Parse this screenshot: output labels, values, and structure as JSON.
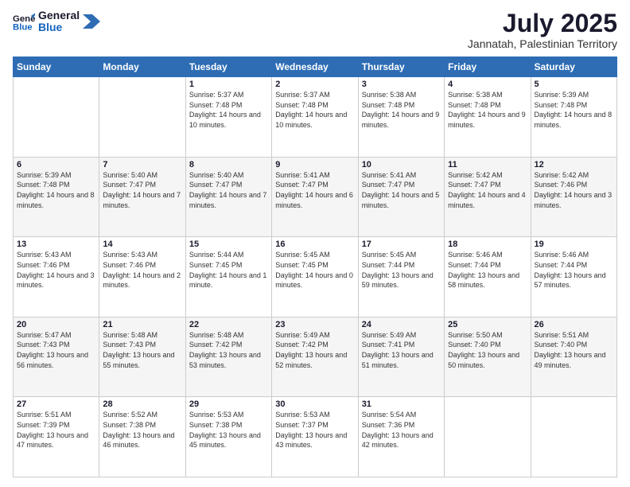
{
  "logo": {
    "line1": "General",
    "line2": "Blue"
  },
  "title": "July 2025",
  "subtitle": "Jannatah, Palestinian Territory",
  "days_of_week": [
    "Sunday",
    "Monday",
    "Tuesday",
    "Wednesday",
    "Thursday",
    "Friday",
    "Saturday"
  ],
  "weeks": [
    [
      {
        "day": "",
        "info": ""
      },
      {
        "day": "",
        "info": ""
      },
      {
        "day": "1",
        "info": "Sunrise: 5:37 AM\nSunset: 7:48 PM\nDaylight: 14 hours and 10 minutes."
      },
      {
        "day": "2",
        "info": "Sunrise: 5:37 AM\nSunset: 7:48 PM\nDaylight: 14 hours and 10 minutes."
      },
      {
        "day": "3",
        "info": "Sunrise: 5:38 AM\nSunset: 7:48 PM\nDaylight: 14 hours and 9 minutes."
      },
      {
        "day": "4",
        "info": "Sunrise: 5:38 AM\nSunset: 7:48 PM\nDaylight: 14 hours and 9 minutes."
      },
      {
        "day": "5",
        "info": "Sunrise: 5:39 AM\nSunset: 7:48 PM\nDaylight: 14 hours and 8 minutes."
      }
    ],
    [
      {
        "day": "6",
        "info": "Sunrise: 5:39 AM\nSunset: 7:48 PM\nDaylight: 14 hours and 8 minutes."
      },
      {
        "day": "7",
        "info": "Sunrise: 5:40 AM\nSunset: 7:47 PM\nDaylight: 14 hours and 7 minutes."
      },
      {
        "day": "8",
        "info": "Sunrise: 5:40 AM\nSunset: 7:47 PM\nDaylight: 14 hours and 7 minutes."
      },
      {
        "day": "9",
        "info": "Sunrise: 5:41 AM\nSunset: 7:47 PM\nDaylight: 14 hours and 6 minutes."
      },
      {
        "day": "10",
        "info": "Sunrise: 5:41 AM\nSunset: 7:47 PM\nDaylight: 14 hours and 5 minutes."
      },
      {
        "day": "11",
        "info": "Sunrise: 5:42 AM\nSunset: 7:47 PM\nDaylight: 14 hours and 4 minutes."
      },
      {
        "day": "12",
        "info": "Sunrise: 5:42 AM\nSunset: 7:46 PM\nDaylight: 14 hours and 3 minutes."
      }
    ],
    [
      {
        "day": "13",
        "info": "Sunrise: 5:43 AM\nSunset: 7:46 PM\nDaylight: 14 hours and 3 minutes."
      },
      {
        "day": "14",
        "info": "Sunrise: 5:43 AM\nSunset: 7:46 PM\nDaylight: 14 hours and 2 minutes."
      },
      {
        "day": "15",
        "info": "Sunrise: 5:44 AM\nSunset: 7:45 PM\nDaylight: 14 hours and 1 minute."
      },
      {
        "day": "16",
        "info": "Sunrise: 5:45 AM\nSunset: 7:45 PM\nDaylight: 14 hours and 0 minutes."
      },
      {
        "day": "17",
        "info": "Sunrise: 5:45 AM\nSunset: 7:44 PM\nDaylight: 13 hours and 59 minutes."
      },
      {
        "day": "18",
        "info": "Sunrise: 5:46 AM\nSunset: 7:44 PM\nDaylight: 13 hours and 58 minutes."
      },
      {
        "day": "19",
        "info": "Sunrise: 5:46 AM\nSunset: 7:44 PM\nDaylight: 13 hours and 57 minutes."
      }
    ],
    [
      {
        "day": "20",
        "info": "Sunrise: 5:47 AM\nSunset: 7:43 PM\nDaylight: 13 hours and 56 minutes."
      },
      {
        "day": "21",
        "info": "Sunrise: 5:48 AM\nSunset: 7:43 PM\nDaylight: 13 hours and 55 minutes."
      },
      {
        "day": "22",
        "info": "Sunrise: 5:48 AM\nSunset: 7:42 PM\nDaylight: 13 hours and 53 minutes."
      },
      {
        "day": "23",
        "info": "Sunrise: 5:49 AM\nSunset: 7:42 PM\nDaylight: 13 hours and 52 minutes."
      },
      {
        "day": "24",
        "info": "Sunrise: 5:49 AM\nSunset: 7:41 PM\nDaylight: 13 hours and 51 minutes."
      },
      {
        "day": "25",
        "info": "Sunrise: 5:50 AM\nSunset: 7:40 PM\nDaylight: 13 hours and 50 minutes."
      },
      {
        "day": "26",
        "info": "Sunrise: 5:51 AM\nSunset: 7:40 PM\nDaylight: 13 hours and 49 minutes."
      }
    ],
    [
      {
        "day": "27",
        "info": "Sunrise: 5:51 AM\nSunset: 7:39 PM\nDaylight: 13 hours and 47 minutes."
      },
      {
        "day": "28",
        "info": "Sunrise: 5:52 AM\nSunset: 7:38 PM\nDaylight: 13 hours and 46 minutes."
      },
      {
        "day": "29",
        "info": "Sunrise: 5:53 AM\nSunset: 7:38 PM\nDaylight: 13 hours and 45 minutes."
      },
      {
        "day": "30",
        "info": "Sunrise: 5:53 AM\nSunset: 7:37 PM\nDaylight: 13 hours and 43 minutes."
      },
      {
        "day": "31",
        "info": "Sunrise: 5:54 AM\nSunset: 7:36 PM\nDaylight: 13 hours and 42 minutes."
      },
      {
        "day": "",
        "info": ""
      },
      {
        "day": "",
        "info": ""
      }
    ]
  ]
}
